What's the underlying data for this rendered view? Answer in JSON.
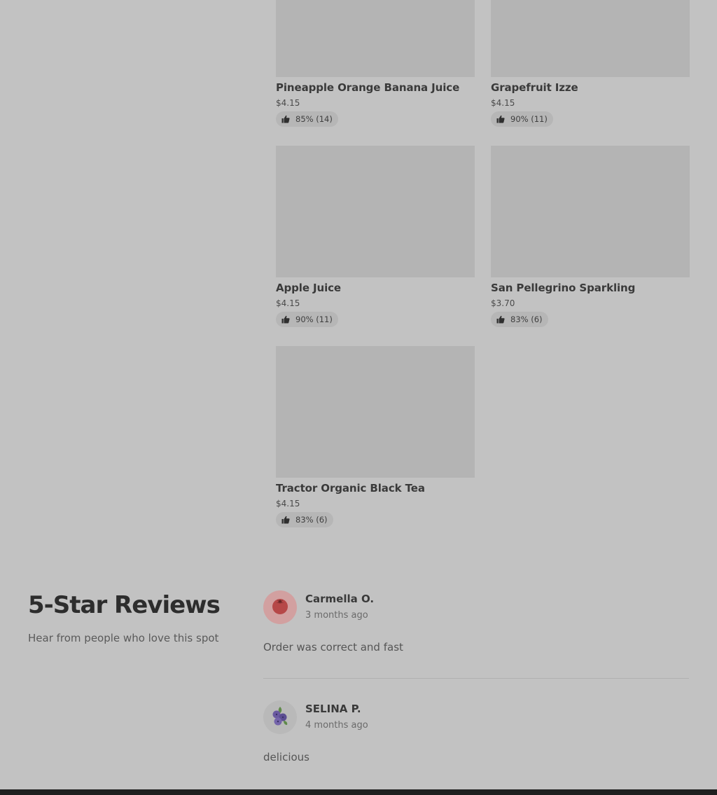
{
  "menu_items": [
    {
      "name": "Pineapple Orange Banana Juice",
      "price": "$4.15",
      "rating": "85% (14)"
    },
    {
      "name": "Grapefruit Izze",
      "price": "$4.15",
      "rating": "90% (11)"
    },
    {
      "name": "Apple Juice",
      "price": "$4.15",
      "rating": "90% (11)"
    },
    {
      "name": "San Pellegrino Sparkling",
      "price": "$3.70",
      "rating": "83% (6)"
    },
    {
      "name": "Tractor Organic Black Tea",
      "price": "$4.15",
      "rating": "83% (6)"
    }
  ],
  "reviews_section": {
    "title": "5-Star Reviews",
    "subtitle": "Hear from people who love this spot",
    "reviews": [
      {
        "author": "Carmella O.",
        "when": "3 months ago",
        "text": "Order was correct and fast",
        "avatar_icon": "tomato-icon"
      },
      {
        "author": "SELINA P.",
        "when": "4 months ago",
        "text": "delicious",
        "avatar_icon": "blueberry-icon"
      }
    ]
  },
  "colors": {
    "background": "#c2c2c2",
    "image_placeholder": "#b4b4b4",
    "rating_pill": "#b6b6b6"
  }
}
